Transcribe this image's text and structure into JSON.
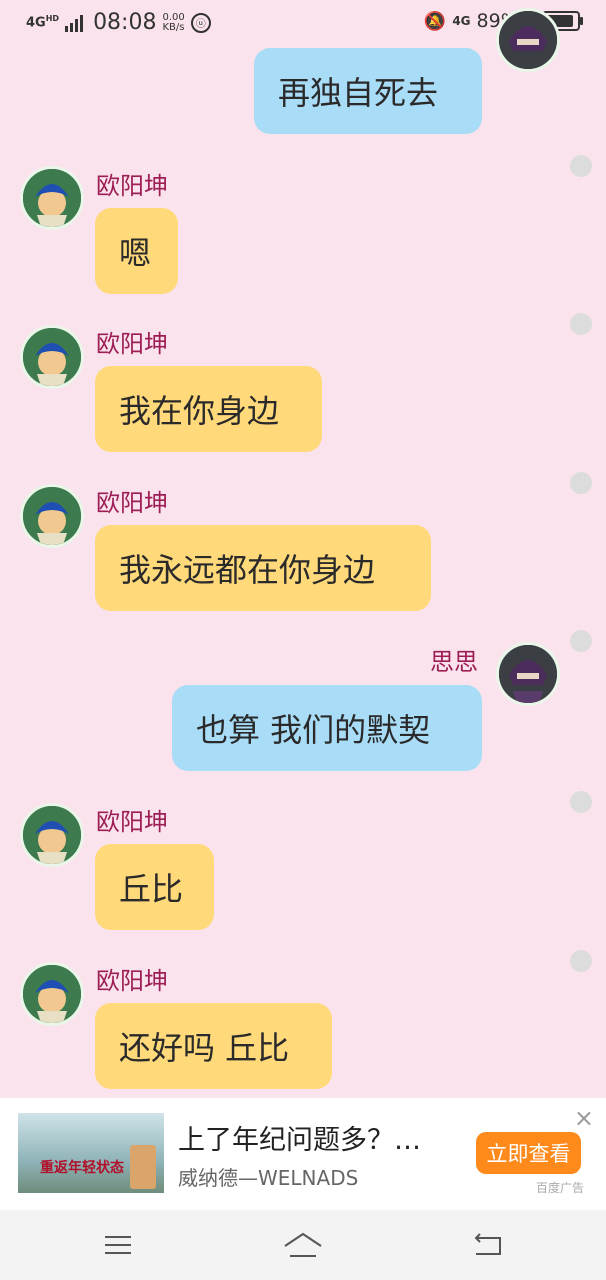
{
  "status_bar": {
    "network_left": "4G",
    "network_left_sup": "HD",
    "time": "08:08",
    "speed_value": "0.00",
    "speed_unit": "KB/s",
    "network_right": "4G",
    "battery": "89%"
  },
  "messages": [
    {
      "side": "right",
      "name": "",
      "text": "再独自死去"
    },
    {
      "side": "left",
      "name": "欧阳坤",
      "text": "嗯"
    },
    {
      "side": "left",
      "name": "欧阳坤",
      "text": "我在你身边"
    },
    {
      "side": "left",
      "name": "欧阳坤",
      "text": "我永远都在你身边"
    },
    {
      "side": "right",
      "name": "思思",
      "text": "也算 我们的默契"
    },
    {
      "side": "left",
      "name": "欧阳坤",
      "text": "丘比"
    },
    {
      "side": "left",
      "name": "欧阳坤",
      "text": "还好吗 丘比"
    }
  ],
  "ad": {
    "thumb_text": "重返年轻状态",
    "title": "上了年纪问题多？…",
    "advertiser": "威纳德—WELNADS",
    "cta": "立即查看",
    "label": "百度广告",
    "close": "×"
  },
  "colors": {
    "background": "#fae3ec",
    "left_bubble": "#ffd97a",
    "right_bubble": "#a9dcf7",
    "name": "#9d1e56",
    "cta": "#ff8a1c"
  }
}
